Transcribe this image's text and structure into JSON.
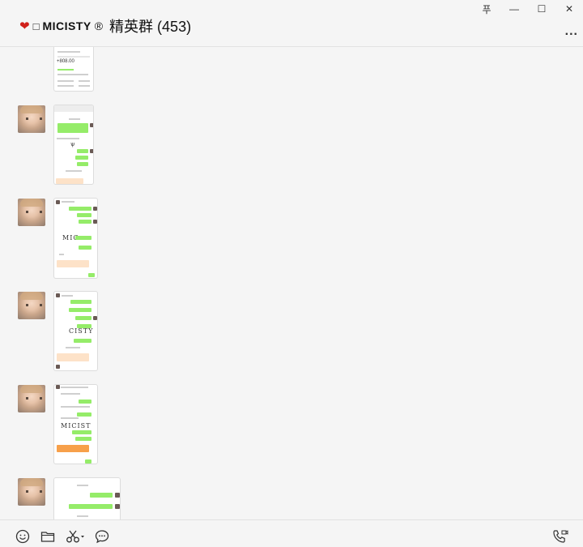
{
  "window": {
    "title_heart": "❤",
    "title_box": "□",
    "title_brand": "MICISTY",
    "title_reg": "®",
    "title_group": "精英群 (453)",
    "controls": {
      "pin": "푸",
      "minimize": "—",
      "maximize": "☐",
      "close": "✕"
    },
    "more": "..."
  },
  "chat": {
    "messages": [
      {
        "type": "image",
        "amount": "+808.00"
      },
      {
        "type": "image",
        "logo": ""
      },
      {
        "type": "image",
        "logo": "MIC"
      },
      {
        "type": "image",
        "logo": "CISTY"
      },
      {
        "type": "image",
        "logo": "MICIST"
      },
      {
        "type": "image",
        "logo": ""
      }
    ]
  },
  "toolbar": {
    "emoji": "emoji-icon",
    "folder": "folder-icon",
    "scissors": "scissors-icon",
    "chat_history": "chat-bubble-icon",
    "call": "phone-video-icon"
  },
  "colors": {
    "bg": "#f5f5f5",
    "green_bubble": "#95ec69",
    "heart": "#d0201a"
  }
}
